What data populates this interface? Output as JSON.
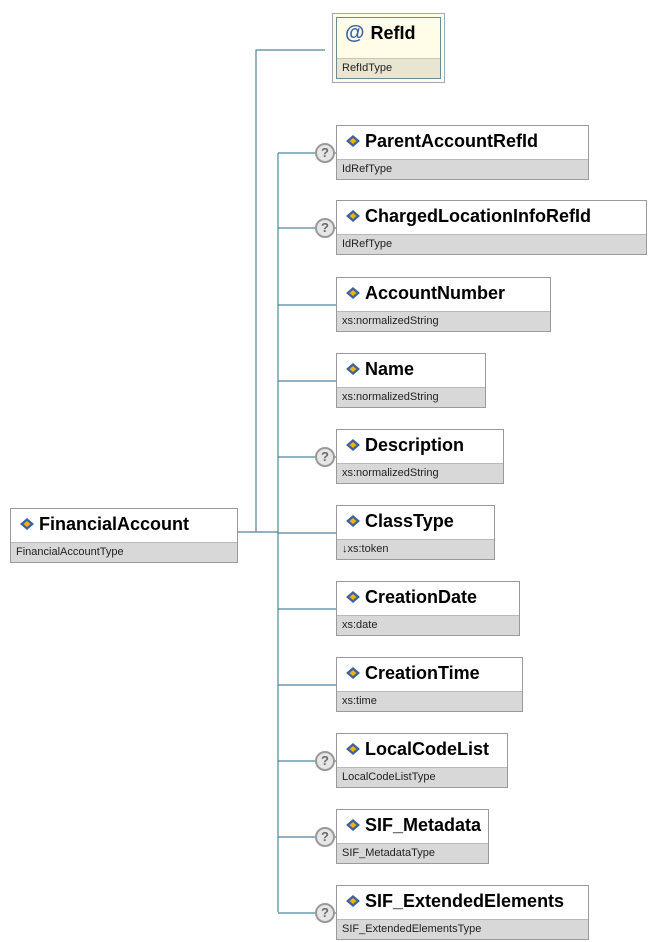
{
  "root": {
    "name": "FinancialAccount",
    "type": "FinancialAccountType"
  },
  "attribute": {
    "name": "RefId",
    "type": "RefIdType",
    "symbol": "@"
  },
  "children": [
    {
      "name": "ParentAccountRefId",
      "type": "IdRefType",
      "optional": true
    },
    {
      "name": "ChargedLocationInfoRefId",
      "type": "IdRefType",
      "optional": true
    },
    {
      "name": "AccountNumber",
      "type": "xs:normalizedString",
      "optional": false
    },
    {
      "name": "Name",
      "type": "xs:normalizedString",
      "optional": false
    },
    {
      "name": "Description",
      "type": "xs:normalizedString",
      "optional": true
    },
    {
      "name": "ClassType",
      "type": "↓xs:token",
      "optional": false
    },
    {
      "name": "CreationDate",
      "type": "xs:date",
      "optional": false
    },
    {
      "name": "CreationTime",
      "type": "xs:time",
      "optional": false
    },
    {
      "name": "LocalCodeList",
      "type": "LocalCodeListType",
      "optional": true
    },
    {
      "name": "SIF_Metadata",
      "type": "SIF_MetadataType",
      "optional": true
    },
    {
      "name": "SIF_ExtendedElements",
      "type": "SIF_ExtendedElementsType",
      "optional": true
    }
  ],
  "optional_symbol": "?",
  "icons": {
    "element": "element-diamond-icon",
    "attribute": "attribute-at-icon",
    "optional": "question-icon"
  },
  "colors": {
    "connector": "#4f8599",
    "icon_blue": "#3a61a8",
    "icon_yellow": "#f0b400",
    "type_band": "#d8d8d8"
  }
}
